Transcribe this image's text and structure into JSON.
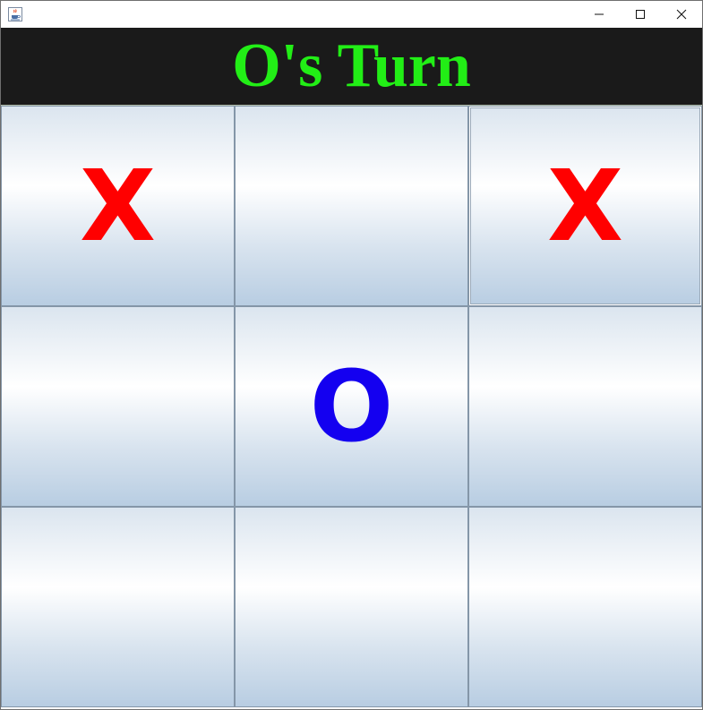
{
  "window": {
    "title": "",
    "icon": "java-cup-icon",
    "controls": [
      "minimize-icon",
      "maximize-icon",
      "close-icon"
    ]
  },
  "banner": {
    "text": "O's Turn",
    "color": "#22ee16",
    "background": "#1a1a1a"
  },
  "board": {
    "cells": [
      {
        "value": "X",
        "player": "x"
      },
      {
        "value": "",
        "player": ""
      },
      {
        "value": "X",
        "player": "x"
      },
      {
        "value": "",
        "player": ""
      },
      {
        "value": "O",
        "player": "o"
      },
      {
        "value": "",
        "player": ""
      },
      {
        "value": "",
        "player": ""
      },
      {
        "value": "",
        "player": ""
      },
      {
        "value": "",
        "player": ""
      }
    ],
    "x_color": "#ff0000",
    "o_color": "#1400f0"
  }
}
